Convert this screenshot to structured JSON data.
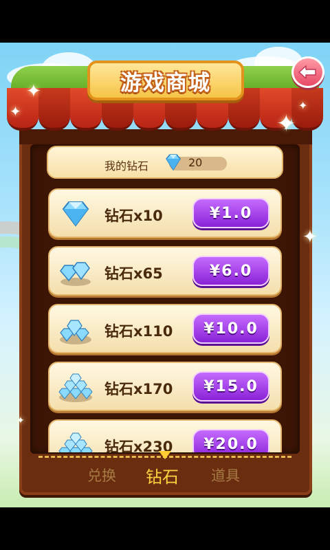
{
  "header": {
    "title": "游戏商城",
    "back_icon": "back-arrow-icon"
  },
  "balance": {
    "label": "我的钻石",
    "icon": "diamond-icon",
    "value": "20"
  },
  "items": [
    {
      "name": "钻石x10",
      "price": "¥1.0",
      "icon": "diamond-single-icon"
    },
    {
      "name": "钻石x65",
      "price": "¥6.0",
      "icon": "diamond-pair-icon"
    },
    {
      "name": "钻石x110",
      "price": "¥10.0",
      "icon": "diamond-pile-small-icon"
    },
    {
      "name": "钻石x170",
      "price": "¥15.0",
      "icon": "diamond-pile-medium-icon"
    },
    {
      "name": "钻石x230",
      "price": "¥20.0",
      "icon": "diamond-pile-large-icon"
    }
  ],
  "tabs": [
    {
      "label": "兑换",
      "active": false
    },
    {
      "label": "钻石",
      "active": true
    },
    {
      "label": "道具",
      "active": false
    }
  ],
  "colors": {
    "awning_red": "#d23a1c",
    "awning_green": "#7cc23a",
    "price_button": "#a63ee8",
    "title_plaque": "#f6c447",
    "active_tab": "#ffd23f"
  }
}
